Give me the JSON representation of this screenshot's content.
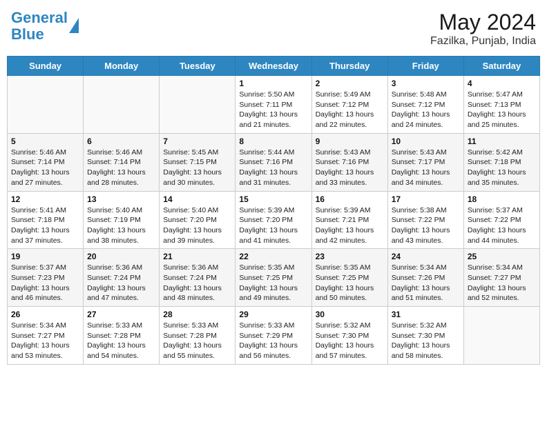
{
  "header": {
    "logo_line1": "General",
    "logo_line2": "Blue",
    "title": "May 2024",
    "subtitle": "Fazilka, Punjab, India"
  },
  "weekdays": [
    "Sunday",
    "Monday",
    "Tuesday",
    "Wednesday",
    "Thursday",
    "Friday",
    "Saturday"
  ],
  "weeks": [
    [
      {
        "day": "",
        "sunrise": "",
        "sunset": "",
        "daylight": ""
      },
      {
        "day": "",
        "sunrise": "",
        "sunset": "",
        "daylight": ""
      },
      {
        "day": "",
        "sunrise": "",
        "sunset": "",
        "daylight": ""
      },
      {
        "day": "1",
        "sunrise": "5:50 AM",
        "sunset": "7:11 PM",
        "daylight": "13 hours and 21 minutes."
      },
      {
        "day": "2",
        "sunrise": "5:49 AM",
        "sunset": "7:12 PM",
        "daylight": "13 hours and 22 minutes."
      },
      {
        "day": "3",
        "sunrise": "5:48 AM",
        "sunset": "7:12 PM",
        "daylight": "13 hours and 24 minutes."
      },
      {
        "day": "4",
        "sunrise": "5:47 AM",
        "sunset": "7:13 PM",
        "daylight": "13 hours and 25 minutes."
      }
    ],
    [
      {
        "day": "5",
        "sunrise": "5:46 AM",
        "sunset": "7:14 PM",
        "daylight": "13 hours and 27 minutes."
      },
      {
        "day": "6",
        "sunrise": "5:46 AM",
        "sunset": "7:14 PM",
        "daylight": "13 hours and 28 minutes."
      },
      {
        "day": "7",
        "sunrise": "5:45 AM",
        "sunset": "7:15 PM",
        "daylight": "13 hours and 30 minutes."
      },
      {
        "day": "8",
        "sunrise": "5:44 AM",
        "sunset": "7:16 PM",
        "daylight": "13 hours and 31 minutes."
      },
      {
        "day": "9",
        "sunrise": "5:43 AM",
        "sunset": "7:16 PM",
        "daylight": "13 hours and 33 minutes."
      },
      {
        "day": "10",
        "sunrise": "5:43 AM",
        "sunset": "7:17 PM",
        "daylight": "13 hours and 34 minutes."
      },
      {
        "day": "11",
        "sunrise": "5:42 AM",
        "sunset": "7:18 PM",
        "daylight": "13 hours and 35 minutes."
      }
    ],
    [
      {
        "day": "12",
        "sunrise": "5:41 AM",
        "sunset": "7:18 PM",
        "daylight": "13 hours and 37 minutes."
      },
      {
        "day": "13",
        "sunrise": "5:40 AM",
        "sunset": "7:19 PM",
        "daylight": "13 hours and 38 minutes."
      },
      {
        "day": "14",
        "sunrise": "5:40 AM",
        "sunset": "7:20 PM",
        "daylight": "13 hours and 39 minutes."
      },
      {
        "day": "15",
        "sunrise": "5:39 AM",
        "sunset": "7:20 PM",
        "daylight": "13 hours and 41 minutes."
      },
      {
        "day": "16",
        "sunrise": "5:39 AM",
        "sunset": "7:21 PM",
        "daylight": "13 hours and 42 minutes."
      },
      {
        "day": "17",
        "sunrise": "5:38 AM",
        "sunset": "7:22 PM",
        "daylight": "13 hours and 43 minutes."
      },
      {
        "day": "18",
        "sunrise": "5:37 AM",
        "sunset": "7:22 PM",
        "daylight": "13 hours and 44 minutes."
      }
    ],
    [
      {
        "day": "19",
        "sunrise": "5:37 AM",
        "sunset": "7:23 PM",
        "daylight": "13 hours and 46 minutes."
      },
      {
        "day": "20",
        "sunrise": "5:36 AM",
        "sunset": "7:24 PM",
        "daylight": "13 hours and 47 minutes."
      },
      {
        "day": "21",
        "sunrise": "5:36 AM",
        "sunset": "7:24 PM",
        "daylight": "13 hours and 48 minutes."
      },
      {
        "day": "22",
        "sunrise": "5:35 AM",
        "sunset": "7:25 PM",
        "daylight": "13 hours and 49 minutes."
      },
      {
        "day": "23",
        "sunrise": "5:35 AM",
        "sunset": "7:25 PM",
        "daylight": "13 hours and 50 minutes."
      },
      {
        "day": "24",
        "sunrise": "5:34 AM",
        "sunset": "7:26 PM",
        "daylight": "13 hours and 51 minutes."
      },
      {
        "day": "25",
        "sunrise": "5:34 AM",
        "sunset": "7:27 PM",
        "daylight": "13 hours and 52 minutes."
      }
    ],
    [
      {
        "day": "26",
        "sunrise": "5:34 AM",
        "sunset": "7:27 PM",
        "daylight": "13 hours and 53 minutes."
      },
      {
        "day": "27",
        "sunrise": "5:33 AM",
        "sunset": "7:28 PM",
        "daylight": "13 hours and 54 minutes."
      },
      {
        "day": "28",
        "sunrise": "5:33 AM",
        "sunset": "7:28 PM",
        "daylight": "13 hours and 55 minutes."
      },
      {
        "day": "29",
        "sunrise": "5:33 AM",
        "sunset": "7:29 PM",
        "daylight": "13 hours and 56 minutes."
      },
      {
        "day": "30",
        "sunrise": "5:32 AM",
        "sunset": "7:30 PM",
        "daylight": "13 hours and 57 minutes."
      },
      {
        "day": "31",
        "sunrise": "5:32 AM",
        "sunset": "7:30 PM",
        "daylight": "13 hours and 58 minutes."
      },
      {
        "day": "",
        "sunrise": "",
        "sunset": "",
        "daylight": ""
      }
    ]
  ],
  "labels": {
    "sunrise": "Sunrise:",
    "sunset": "Sunset:",
    "daylight": "Daylight:"
  }
}
